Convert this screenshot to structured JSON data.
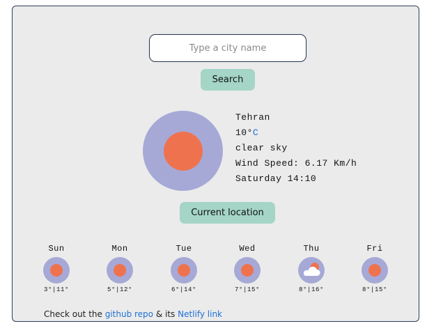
{
  "search": {
    "placeholder": "Type a city name",
    "value": "",
    "button_label": "Search"
  },
  "current": {
    "city": "Tehran",
    "temp_value": "10°",
    "temp_unit": "C",
    "description": "clear sky",
    "wind": "Wind Speed: 6.17 Km/h",
    "datetime": "Saturday 14:10",
    "icon": "sun-icon"
  },
  "location_button_label": "Current location",
  "forecast": [
    {
      "day": "Sun",
      "icon": "sun-icon",
      "temps": "3°|11°"
    },
    {
      "day": "Mon",
      "icon": "sun-icon",
      "temps": "5°|12°"
    },
    {
      "day": "Tue",
      "icon": "sun-icon",
      "temps": "6°|14°"
    },
    {
      "day": "Wed",
      "icon": "sun-icon",
      "temps": "7°|15°"
    },
    {
      "day": "Thu",
      "icon": "partly-cloudy-icon",
      "temps": "8°|16°"
    },
    {
      "day": "Fri",
      "icon": "sun-icon",
      "temps": "8°|15°"
    }
  ],
  "footer": {
    "prefix": "Check out the ",
    "repo_link": "github repo",
    "middle": " & its ",
    "netlify_link": "Netlify link"
  },
  "colors": {
    "card_background": "#ebebeb",
    "button": "#a4d5c7",
    "icon_circle": "#a6a9d6",
    "sun": "#ef724e",
    "link": "#1f6fd6"
  }
}
